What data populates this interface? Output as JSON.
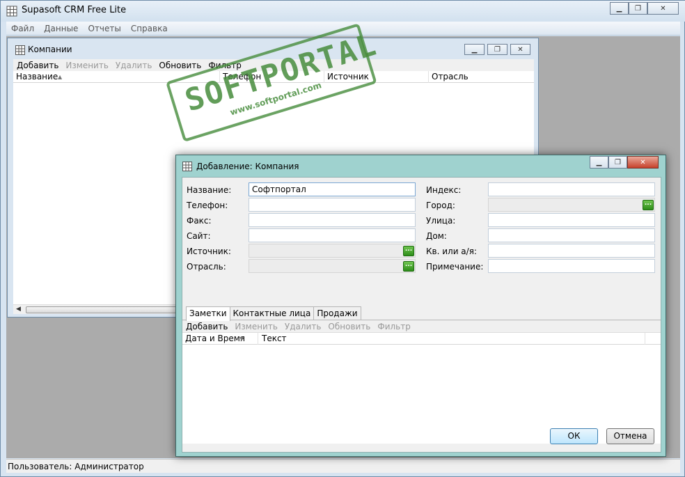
{
  "app": {
    "title": "Supasoft CRM Free Lite"
  },
  "menu": [
    "Файл",
    "Данные",
    "Отчеты",
    "Справка"
  ],
  "companies": {
    "title": "Компании",
    "toolbar": {
      "add": "Добавить",
      "edit": "Изменить",
      "delete": "Удалить",
      "refresh": "Обновить",
      "filter": "Фильтр"
    },
    "columns": [
      "Название",
      "Телефон",
      "Источник",
      "Отрасль"
    ]
  },
  "dialog": {
    "title": "Добавление: Компания",
    "left": {
      "name_label": "Название:",
      "name_value": "Софтпортал",
      "phone_label": "Телефон:",
      "fax_label": "Факс:",
      "site_label": "Сайт:",
      "source_label": "Источник:",
      "industry_label": "Отрасль:"
    },
    "right": {
      "index_label": "Индекс:",
      "city_label": "Город:",
      "street_label": "Улица:",
      "house_label": "Дом:",
      "apt_label": "Кв. или а/я:",
      "note_label": "Примечание:"
    },
    "ellipsis": "...",
    "tabs": [
      "Заметки",
      "Контактные лица",
      "Продажи"
    ],
    "notes_toolbar": {
      "add": "Добавить",
      "edit": "Изменить",
      "delete": "Удалить",
      "refresh": "Обновить",
      "filter": "Фильтр"
    },
    "notes_columns": [
      "Дата и Время",
      "Текст"
    ],
    "ok": "ОК",
    "cancel": "Отмена"
  },
  "statusbar": {
    "user": "Пользователь: Администратор"
  },
  "watermark": {
    "big": "SOFTPORTAL",
    "small": "www.softportal.com"
  },
  "colors": {
    "dialog_frame": "#9fd2cf",
    "window_frame": "#d9e5f1",
    "ellipsis_button": "#3f9f2a",
    "stamp": "#468c3c"
  }
}
